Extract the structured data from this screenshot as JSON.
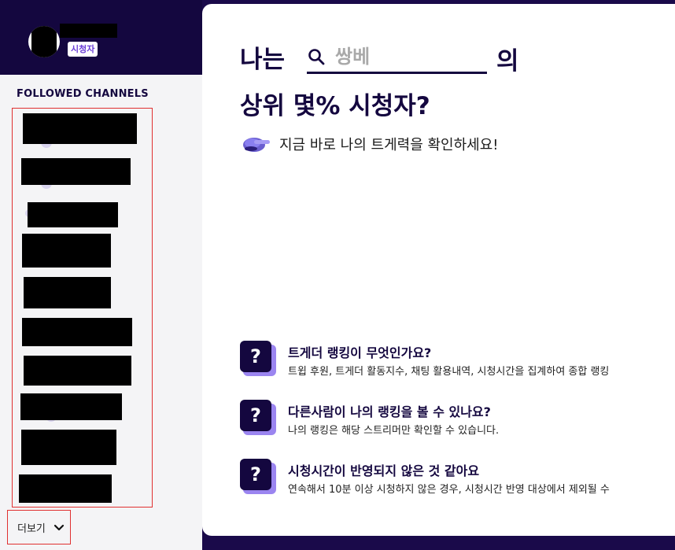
{
  "user": {
    "badge": "시청자"
  },
  "sidebar": {
    "section_title": "FOLLOWED CHANNELS",
    "more_label": "더보기",
    "channel_count_visible": 10
  },
  "hero": {
    "prefix": "나는",
    "search_placeholder": "쌍베",
    "suffix": "의",
    "line2": "상위 몇% 시청자?",
    "cta": "지금 바로 나의 트게력을 확인하세요!"
  },
  "faq": [
    {
      "icon": "question-mark-icon",
      "title": "트게더 랭킹이 무엇인가요?",
      "desc": "트윕 후원, 트게더 활동지수, 채팅 활용내역, 시청시간을 집계하여 종합 랭킹"
    },
    {
      "icon": "question-mark-icon",
      "title": "다른사람이 나의 랭킹을 볼 수 있나요?",
      "desc": "나의 랭킹은 해당 스트리머만 확인할 수 있습니다."
    },
    {
      "icon": "question-mark-icon",
      "title": "시청시간이 반영되지 않은 것 같아요",
      "desc": "연속해서 10분 이상 시청하지 않은 경우, 시청시간 반영 대상에서 제외될 수"
    }
  ],
  "colors": {
    "brand_dark": "#14073f",
    "accent_purple": "#9b85f0",
    "highlight_red": "#e03030"
  }
}
